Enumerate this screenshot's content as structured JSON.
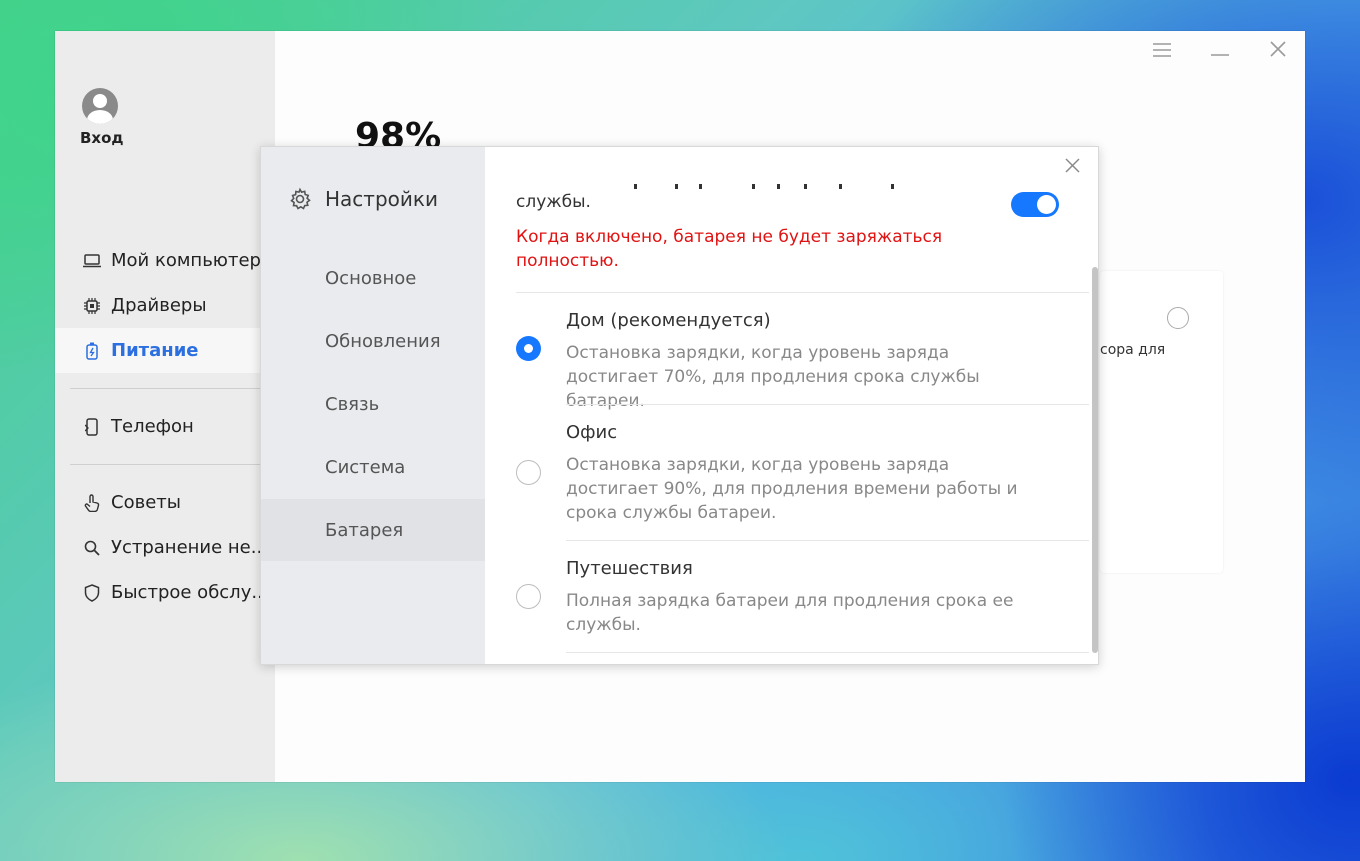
{
  "window": {
    "user": {
      "login_label": "Вход"
    },
    "nav": {
      "items": [
        {
          "label": "Мой компьютер",
          "icon": "laptop-icon"
        },
        {
          "label": "Драйверы",
          "icon": "chip-icon"
        },
        {
          "label": "Питание",
          "icon": "battery-icon",
          "active": true
        },
        {
          "label": "Телефон",
          "icon": "phone-icon"
        },
        {
          "label": "Советы",
          "icon": "hand-pointer-icon"
        },
        {
          "label": "Устранение не...",
          "icon": "search-icon"
        },
        {
          "label": "Быстрое обслу...",
          "icon": "shield-icon"
        }
      ]
    },
    "titlebar": {
      "menu_icon": "hamburger-icon",
      "minimize_icon": "minimize-icon",
      "close_icon": "close-icon"
    },
    "main": {
      "battery_percent": "98%",
      "card_text": "сора для"
    }
  },
  "dialog": {
    "title": "Настройки",
    "tabs": [
      {
        "label": "Основное"
      },
      {
        "label": "Обновления"
      },
      {
        "label": "Связь"
      },
      {
        "label": "Система"
      },
      {
        "label": "Батарея",
        "active": true
      }
    ],
    "content": {
      "partial_text": "службы.",
      "toggle_on": true,
      "warning": "Когда включено, батарея не будет заряжаться полностью.",
      "options": [
        {
          "title": "Дом (рекомендуется)",
          "description": "Остановка зарядки, когда уровень заряда достигает 70%, для продления срока службы батареи.",
          "selected": true
        },
        {
          "title": "Офис",
          "description": "Остановка зарядки, когда уровень заряда достигает 90%, для продления времени работы и срока службы батареи.",
          "selected": false
        },
        {
          "title": "Путешествия",
          "description": "Полная зарядка батареи для продления срока ее службы.",
          "selected": false
        }
      ]
    }
  },
  "colors": {
    "accent": "#1677ff",
    "active_nav": "#2c6fe0",
    "warning": "#e01212"
  }
}
